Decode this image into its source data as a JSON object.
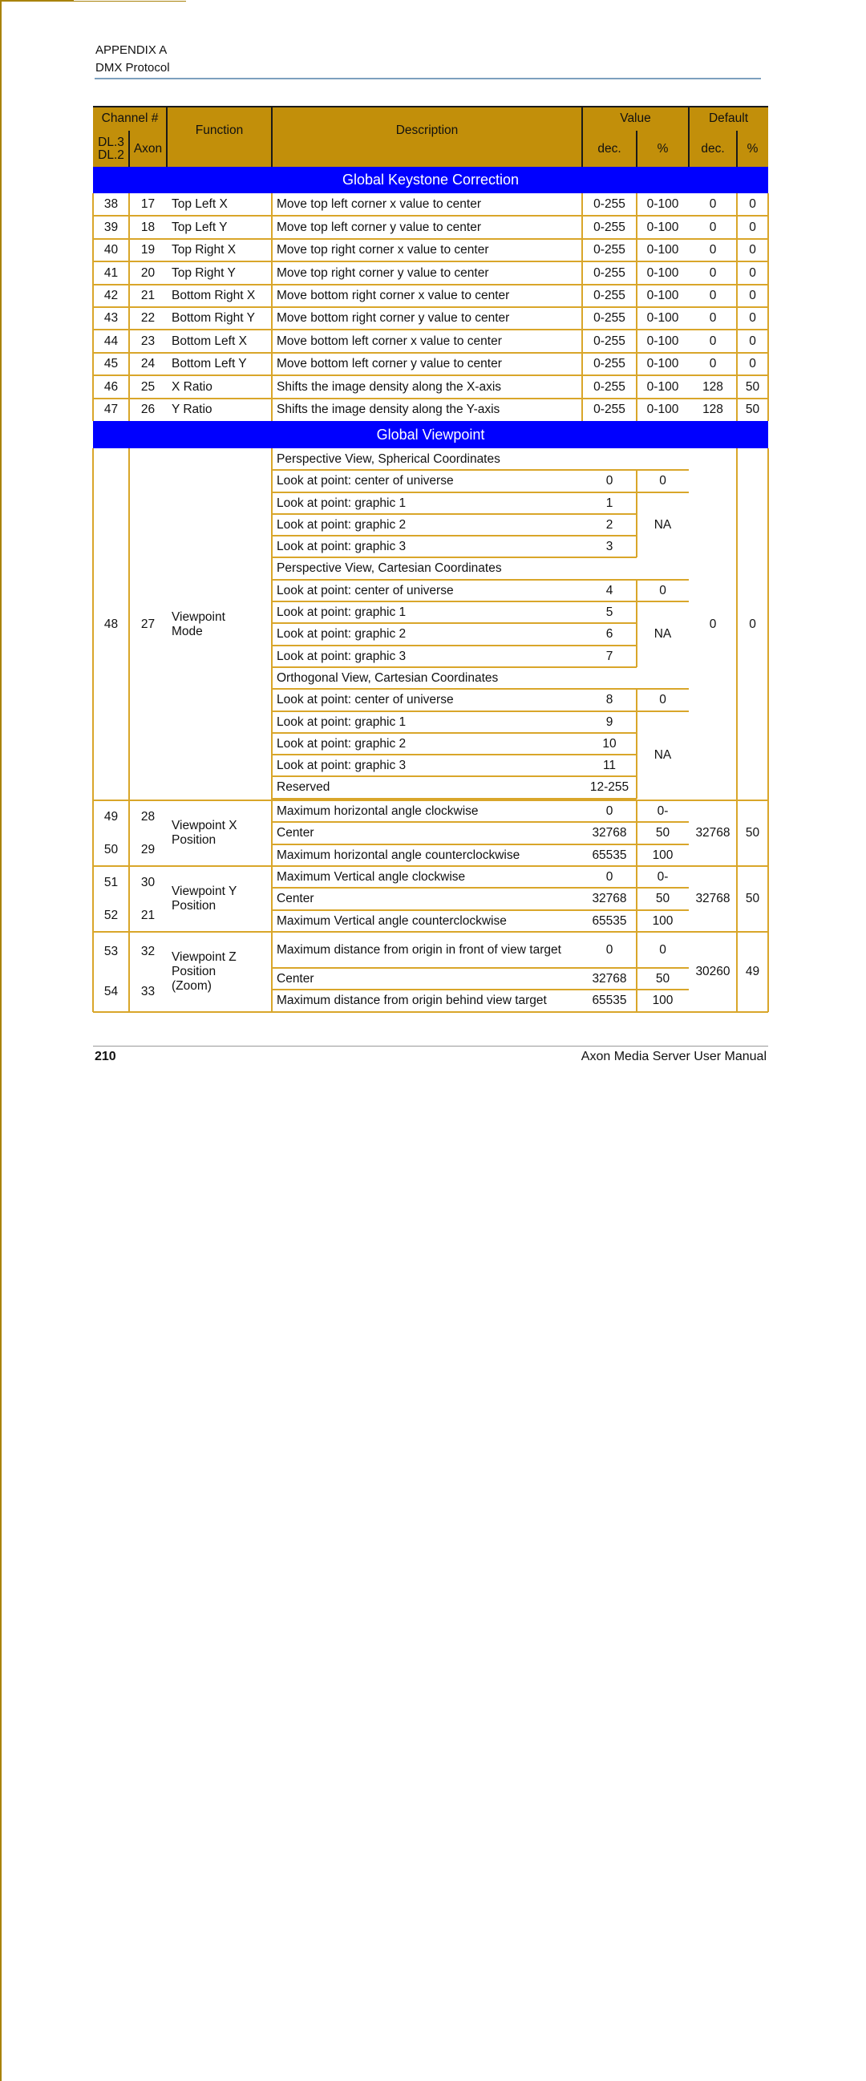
{
  "page_header": {
    "line1": "APPENDIX A",
    "line2": "DMX Protocol"
  },
  "table_header": {
    "channel": "Channel #",
    "dl": "DL.3\nDL.2",
    "dl_line1": "DL.3",
    "dl_line2": "DL.2",
    "axon": "Axon",
    "function": "Function",
    "description": "Description",
    "value": "Value",
    "default": "Default",
    "dec": "dec.",
    "pct": "%"
  },
  "sections": {
    "keystone": "Global Keystone Correction",
    "viewpoint": "Global Viewpoint"
  },
  "keystone_rows": [
    {
      "dl": "38",
      "axon": "17",
      "function": "Top Left X",
      "description": "Move top left corner x value to center",
      "val_dec": "0-255",
      "val_pct": "0-100",
      "def_dec": "0",
      "def_pct": "0"
    },
    {
      "dl": "39",
      "axon": "18",
      "function": "Top Left Y",
      "description": "Move top left corner y value to center",
      "val_dec": "0-255",
      "val_pct": "0-100",
      "def_dec": "0",
      "def_pct": "0"
    },
    {
      "dl": "40",
      "axon": "19",
      "function": "Top Right X",
      "description": "Move top right corner x value to center",
      "val_dec": "0-255",
      "val_pct": "0-100",
      "def_dec": "0",
      "def_pct": "0"
    },
    {
      "dl": "41",
      "axon": "20",
      "function": "Top Right Y",
      "description": "Move top right corner y value to center",
      "val_dec": "0-255",
      "val_pct": "0-100",
      "def_dec": "0",
      "def_pct": "0"
    },
    {
      "dl": "42",
      "axon": "21",
      "function": "Bottom Right X",
      "description": "Move bottom right corner x value to center",
      "val_dec": "0-255",
      "val_pct": "0-100",
      "def_dec": "0",
      "def_pct": "0"
    },
    {
      "dl": "43",
      "axon": "22",
      "function": "Bottom Right Y",
      "description": "Move bottom right corner y value to center",
      "val_dec": "0-255",
      "val_pct": "0-100",
      "def_dec": "0",
      "def_pct": "0"
    },
    {
      "dl": "44",
      "axon": "23",
      "function": "Bottom Left X",
      "description": "Move bottom left corner x value to center",
      "val_dec": "0-255",
      "val_pct": "0-100",
      "def_dec": "0",
      "def_pct": "0"
    },
    {
      "dl": "45",
      "axon": "24",
      "function": "Bottom Left Y",
      "description": "Move bottom left corner y value to center",
      "val_dec": "0-255",
      "val_pct": "0-100",
      "def_dec": "0",
      "def_pct": "0"
    },
    {
      "dl": "46",
      "axon": "25",
      "function": "X Ratio",
      "description": "Shifts the image density along the X-axis",
      "val_dec": "0-255",
      "val_pct": "0-100",
      "def_dec": "128",
      "def_pct": "50"
    },
    {
      "dl": "47",
      "axon": "26",
      "function": "Y Ratio",
      "description": "Shifts the image density along the Y-axis",
      "val_dec": "0-255",
      "val_pct": "0-100",
      "def_dec": "128",
      "def_pct": "50"
    }
  ],
  "viewpoint_mode": {
    "dl": "48",
    "axon": "27",
    "function": "Viewpoint Mode",
    "def_dec": "0",
    "def_pct": "0",
    "groups": [
      {
        "title": "Perspective View, Spherical Coordinates",
        "rows": [
          {
            "desc": "Look at point: center of universe",
            "dec": "0",
            "pct": "0"
          },
          {
            "desc": "Look at point: graphic 1",
            "dec": "1"
          },
          {
            "desc": "Look at point: graphic 2",
            "dec": "2"
          },
          {
            "desc": "Look at point: graphic 3",
            "dec": "3"
          }
        ],
        "na": "NA"
      },
      {
        "title": "Perspective View, Cartesian Coordinates",
        "rows": [
          {
            "desc": "Look at point: center of universe",
            "dec": "4",
            "pct": "0"
          },
          {
            "desc": "Look at point: graphic 1",
            "dec": "5"
          },
          {
            "desc": "Look at point: graphic 2",
            "dec": "6"
          },
          {
            "desc": "Look at point: graphic 3",
            "dec": "7"
          }
        ],
        "na": "NA"
      },
      {
        "title": "Orthogonal View, Cartesian Coordinates",
        "rows": [
          {
            "desc": "Look at point: center of universe",
            "dec": "8",
            "pct": "0"
          },
          {
            "desc": "Look at point: graphic 1",
            "dec": "9"
          },
          {
            "desc": "Look at point: graphic 2",
            "dec": "10"
          },
          {
            "desc": "Look at point: graphic 3",
            "dec": "11"
          },
          {
            "desc": "Reserved",
            "dec": "12-255"
          }
        ],
        "na": "NA"
      }
    ]
  },
  "position_blocks": [
    {
      "dl": [
        "49",
        "50"
      ],
      "axon": [
        "28",
        "29"
      ],
      "function": "Viewpoint X Position",
      "rows": [
        {
          "desc": "Maximum horizontal angle clockwise",
          "dec": "0",
          "pct": "0-"
        },
        {
          "desc": "Center",
          "dec": "32768",
          "pct": "50"
        },
        {
          "desc": "Maximum horizontal angle counterclockwise",
          "dec": "65535",
          "pct": "100"
        }
      ],
      "def_dec": "32768",
      "def_pct": "50"
    },
    {
      "dl": [
        "51",
        "52"
      ],
      "axon": [
        "30",
        "21"
      ],
      "function": "Viewpoint Y Position",
      "rows": [
        {
          "desc": "Maximum Vertical angle clockwise",
          "dec": "0",
          "pct": "0-"
        },
        {
          "desc": "Center",
          "dec": "32768",
          "pct": "50"
        },
        {
          "desc": "Maximum Vertical angle counterclockwise",
          "dec": "65535",
          "pct": "100"
        }
      ],
      "def_dec": "32768",
      "def_pct": "50"
    },
    {
      "dl": [
        "53",
        "54"
      ],
      "axon": [
        "32",
        "33"
      ],
      "function": "Viewpoint Z Position (Zoom)",
      "rows": [
        {
          "desc": "Maximum distance from origin in front of view target",
          "dec": "0",
          "pct": "0"
        },
        {
          "desc": "Center",
          "dec": "32768",
          "pct": "50"
        },
        {
          "desc": "Maximum distance from origin behind view target",
          "dec": "65535",
          "pct": "100"
        }
      ],
      "def_dec": "30260",
      "def_pct": "49"
    }
  ],
  "footer": {
    "page_number": "210",
    "manual_title": "Axon Media Server User Manual"
  },
  "colors": {
    "header_bg": "#c28f0a",
    "section_band": "#0000ff",
    "grid_line": "#d9a62a",
    "header_rule": "#7da0be"
  }
}
